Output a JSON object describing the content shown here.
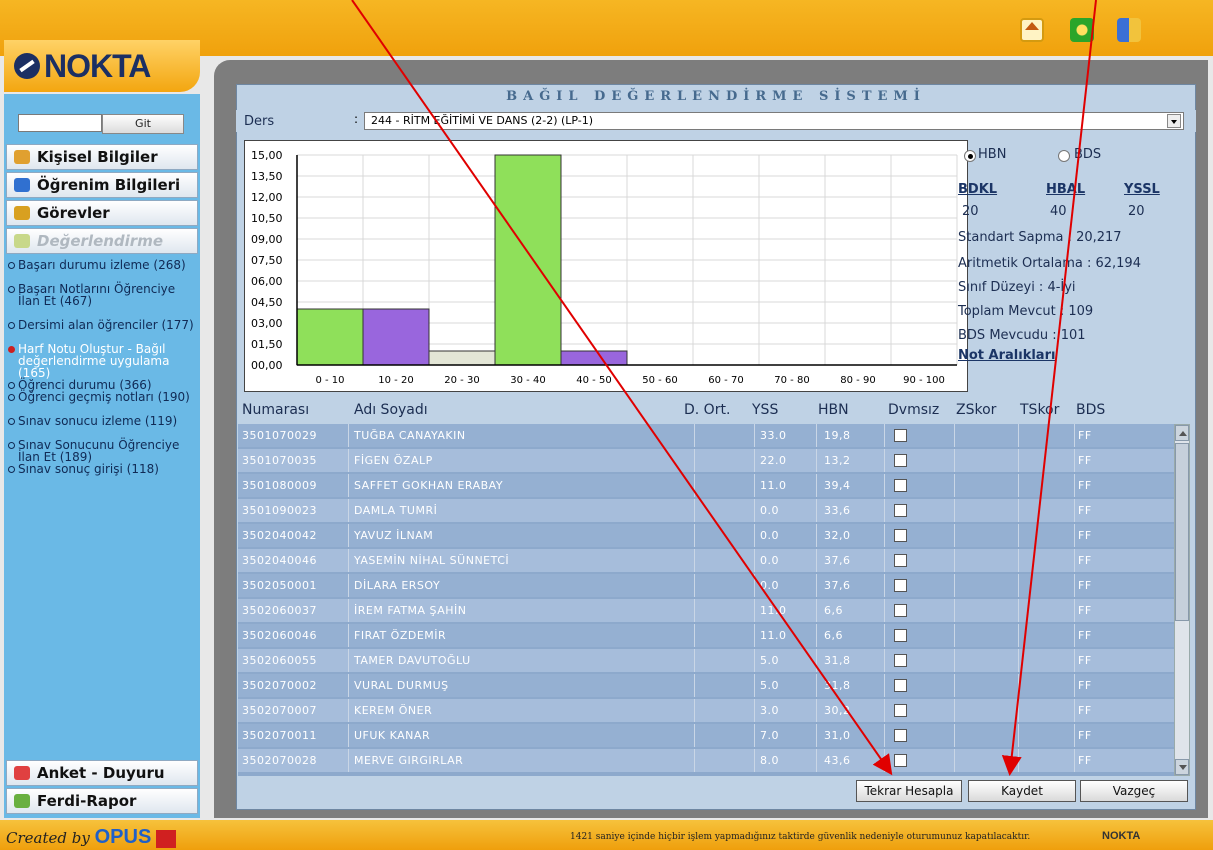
{
  "logo": "NOKTA",
  "sidebar": {
    "git_label": "Git",
    "menus": [
      {
        "label": "Kişisel Bilgiler",
        "icon": "person-icon"
      },
      {
        "label": "Öğrenim Bilgileri",
        "icon": "student-icon"
      },
      {
        "label": "Görevler",
        "icon": "tasks-icon"
      },
      {
        "label": "Değerlendirme",
        "icon": "evaluation-icon"
      }
    ],
    "sub_items": [
      "Başarı durumu izleme (268)",
      "Başarı Notlarını Öğrenciye İlan Et (467)",
      "Dersimi alan öğrenciler (177)",
      "Harf Notu Oluştur - Bağıl değerlendirme uygulama (165)",
      "Öğrenci durumu (366)",
      "Öğrenci geçmiş notları (190)",
      "Sınav sonucu izleme (119)",
      "Sınav Sonucunu Öğrenciye İlan Et (189)",
      "Sınav sonuç girişi (118)"
    ],
    "bottom_menus": [
      {
        "label": "Anket - Duyuru",
        "icon": "check-icon"
      },
      {
        "label": "Ferdi-Rapor",
        "icon": "report-icon"
      }
    ]
  },
  "panel": {
    "title": "BAĞIL DEĞERLENDİRME SİSTEMİ",
    "ders_label": "Ders",
    "ders_colon": ":",
    "ders_value": "244 - RİTM EĞİTİMİ VE DANS (2-2) (LP-1)"
  },
  "stats": {
    "radio_hbn": "HBN",
    "radio_bds": "BDS",
    "headers": [
      "BDKL",
      "HBAL",
      "YSSL"
    ],
    "values": [
      "20",
      "40",
      "20"
    ],
    "std": "Standart Sapma : 20,217",
    "mean": "Aritmetik Ortalama : 62,194",
    "level": "Sınıf Düzeyi : 4-İyi",
    "total": "Toplam Mevcut : 109",
    "bds_count": "BDS Mevcudu : 101",
    "not_araliklari": "Not Aralıkları"
  },
  "chart_data": {
    "type": "bar",
    "categories": [
      "0 - 10",
      "10 - 20",
      "20 - 30",
      "30 - 40",
      "40 - 50",
      "50 - 60",
      "60 - 70",
      "70 - 80",
      "80 - 90",
      "90 - 100"
    ],
    "values": [
      4,
      4,
      1,
      15,
      1,
      0,
      0,
      0,
      0,
      0
    ],
    "colors": [
      "#8fe05a",
      "#9966dd",
      "#e3e6d6",
      "#8fe05a",
      "#9966dd",
      "#8fe05a",
      "#9966dd",
      "#8fe05a",
      "#9966dd",
      "#8fe05a"
    ],
    "yticks": [
      "00,00",
      "01,50",
      "03,00",
      "04,50",
      "06,00",
      "07,50",
      "09,00",
      "10,50",
      "12,00",
      "13,50",
      "15,00"
    ],
    "ylim": [
      0,
      15
    ],
    "grid": true
  },
  "table": {
    "headers": [
      "Numarası",
      "Adı Soyadı",
      "D. Ort.",
      "YSS",
      "HBN",
      "Dvmsız",
      "ZSkor",
      "TSkor",
      "BDS"
    ],
    "rows": [
      {
        "no": "3501070029",
        "name": "TUĞBA CANAYAKIN",
        "yss": "33.0",
        "hbn": "19,8",
        "bds": "FF"
      },
      {
        "no": "3501070035",
        "name": "FİGEN ÖZALP",
        "yss": "22.0",
        "hbn": "13,2",
        "bds": "FF"
      },
      {
        "no": "3501080009",
        "name": "SAFFET GOKHAN ERABAY",
        "yss": "11.0",
        "hbn": "39,4",
        "bds": "FF"
      },
      {
        "no": "3501090023",
        "name": "DAMLA TUMRİ",
        "yss": "0.0",
        "hbn": "33,6",
        "bds": "FF"
      },
      {
        "no": "3502040042",
        "name": "YAVUZ İLNAM",
        "yss": "0.0",
        "hbn": "32,0",
        "bds": "FF"
      },
      {
        "no": "3502040046",
        "name": "YASEMİN NİHAL SÜNNETCİ",
        "yss": "0.0",
        "hbn": "37,6",
        "bds": "FF"
      },
      {
        "no": "3502050001",
        "name": "DİLARA ERSOY",
        "yss": "0.0",
        "hbn": "37,6",
        "bds": "FF"
      },
      {
        "no": "3502060037",
        "name": "İREM FATMA ŞAHİN",
        "yss": "11.0",
        "hbn": "6,6",
        "bds": "FF"
      },
      {
        "no": "3502060046",
        "name": "FIRAT ÖZDEMİR",
        "yss": "11.0",
        "hbn": "6,6",
        "bds": "FF"
      },
      {
        "no": "3502060055",
        "name": "TAMER DAVUTOĞLU",
        "yss": "5.0",
        "hbn": "31,8",
        "bds": "FF"
      },
      {
        "no": "3502070002",
        "name": "VURAL DURMUŞ",
        "yss": "5.0",
        "hbn": "31,8",
        "bds": "FF"
      },
      {
        "no": "3502070007",
        "name": "KEREM ÖNER",
        "yss": "3.0",
        "hbn": "30,2",
        "bds": "FF"
      },
      {
        "no": "3502070011",
        "name": "UFUK KANAR",
        "yss": "7.0",
        "hbn": "31,0",
        "bds": "FF"
      },
      {
        "no": "3502070028",
        "name": "MERVE GIRGIRLAR",
        "yss": "8.0",
        "hbn": "43,6",
        "bds": "FF"
      }
    ]
  },
  "buttons": {
    "recalc": "Tekrar Hesapla",
    "save": "Kaydet",
    "cancel": "Vazgeç"
  },
  "footer": {
    "created_by": "Created by",
    "brand": "OPUS",
    "message": "1421 saniye içinde hiçbir işlem yapmadığınız taktirde güvenlik nedeniyle oturumunuz kapatılacaktır.",
    "nokta": "NOKTA"
  },
  "colors": {
    "annotation_arrow": "#e00000"
  }
}
